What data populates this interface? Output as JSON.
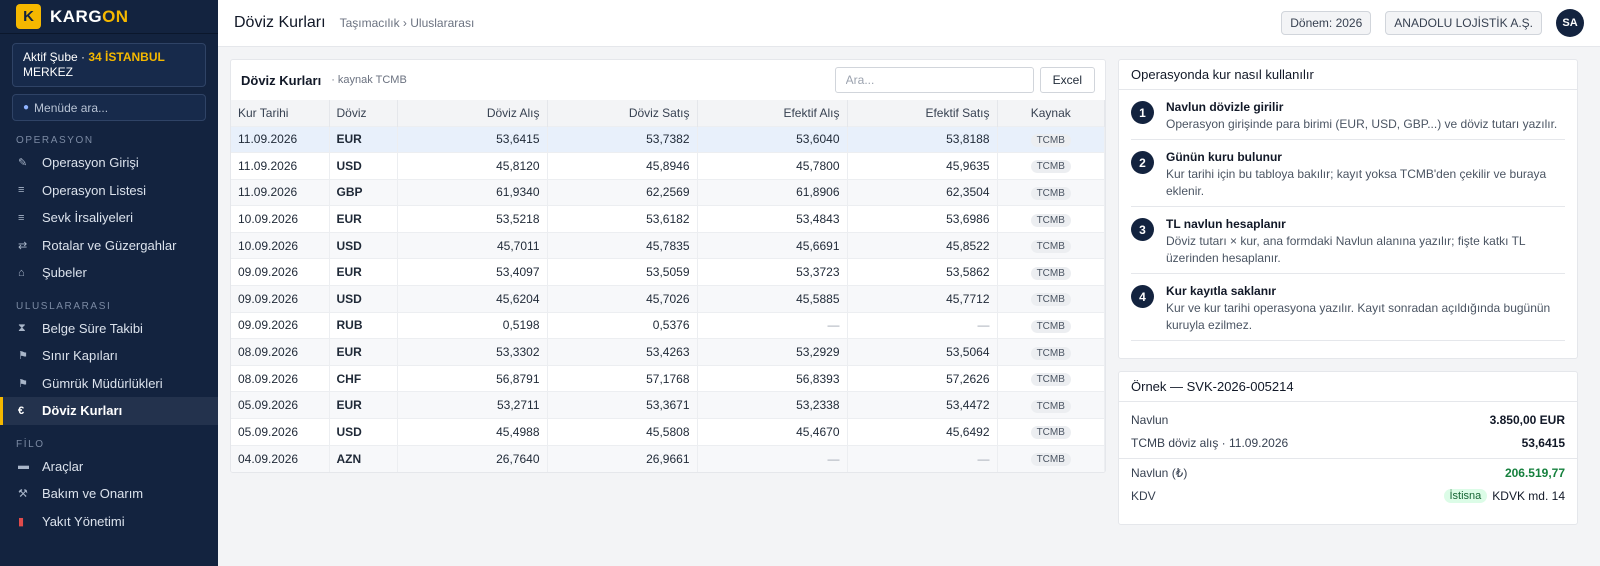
{
  "brand": {
    "logo_letter": "K",
    "name_a": "KARG",
    "name_b": "ON"
  },
  "branch": {
    "label": "Aktif Şube · ",
    "value": "34 İSTANBUL",
    "suffix": "MERKEZ"
  },
  "menu_search": {
    "placeholder": "Menüde ara..."
  },
  "sidebar": {
    "sections": [
      {
        "title": "OPERASYON",
        "items": [
          {
            "label": "Operasyon Girişi",
            "icon": "pencil-icon"
          },
          {
            "label": "Operasyon Listesi",
            "icon": "list-icon"
          },
          {
            "label": "Sevk İrsaliyeleri",
            "icon": "list-icon"
          },
          {
            "label": "Rotalar ve Güzergahlar",
            "icon": "swap-icon"
          },
          {
            "label": "Şubeler",
            "icon": "home-icon"
          }
        ]
      },
      {
        "title": "ULUSLARARASI",
        "items": [
          {
            "label": "Belge Süre Takibi",
            "icon": "hourglass-icon"
          },
          {
            "label": "Sınır Kapıları",
            "icon": "flag-icon"
          },
          {
            "label": "Gümrük Müdürlükleri",
            "icon": "flag-icon"
          },
          {
            "label": "Döviz Kurları",
            "icon": "euro-icon",
            "active": true
          }
        ]
      },
      {
        "title": "FİLO",
        "items": [
          {
            "label": "Araçlar",
            "icon": "truck-icon"
          },
          {
            "label": "Bakım ve Onarım",
            "icon": "wrench-icon"
          },
          {
            "label": "Yakıt Yönetimi",
            "icon": "fuel-icon"
          }
        ]
      }
    ]
  },
  "topbar": {
    "title": "Döviz Kurları",
    "breadcrumb": "Taşımacılık › Uluslararası",
    "period": "Dönem: 2026",
    "company": "ANADOLU LOJİSTİK A.Ş.",
    "avatar": "SA"
  },
  "rates": {
    "title": "Döviz Kurları",
    "subtitle": "· kaynak TCMB",
    "search_placeholder": "Ara...",
    "excel_label": "Excel",
    "columns": [
      "Kur Tarihi",
      "Döviz",
      "Döviz Alış",
      "Döviz Satış",
      "Efektif Alış",
      "Efektif Satış",
      "Kaynak"
    ],
    "rows": [
      [
        "11.09.2026",
        "EUR",
        "53,6415",
        "53,7382",
        "53,6040",
        "53,8188",
        "TCMB"
      ],
      [
        "11.09.2026",
        "USD",
        "45,8120",
        "45,8946",
        "45,7800",
        "45,9635",
        "TCMB"
      ],
      [
        "11.09.2026",
        "GBP",
        "61,9340",
        "62,2569",
        "61,8906",
        "62,3504",
        "TCMB"
      ],
      [
        "10.09.2026",
        "EUR",
        "53,5218",
        "53,6182",
        "53,4843",
        "53,6986",
        "TCMB"
      ],
      [
        "10.09.2026",
        "USD",
        "45,7011",
        "45,7835",
        "45,6691",
        "45,8522",
        "TCMB"
      ],
      [
        "09.09.2026",
        "EUR",
        "53,4097",
        "53,5059",
        "53,3723",
        "53,5862",
        "TCMB"
      ],
      [
        "09.09.2026",
        "USD",
        "45,6204",
        "45,7026",
        "45,5885",
        "45,7712",
        "TCMB"
      ],
      [
        "09.09.2026",
        "RUB",
        "0,5198",
        "0,5376",
        "—",
        "—",
        "TCMB"
      ],
      [
        "08.09.2026",
        "EUR",
        "53,3302",
        "53,4263",
        "53,2929",
        "53,5064",
        "TCMB"
      ],
      [
        "08.09.2026",
        "CHF",
        "56,8791",
        "57,1768",
        "56,8393",
        "57,2626",
        "TCMB"
      ],
      [
        "05.09.2026",
        "EUR",
        "53,2711",
        "53,3671",
        "53,2338",
        "53,4472",
        "TCMB"
      ],
      [
        "05.09.2026",
        "USD",
        "45,4988",
        "45,5808",
        "45,4670",
        "45,6492",
        "TCMB"
      ],
      [
        "04.09.2026",
        "AZN",
        "26,7640",
        "26,9661",
        "—",
        "—",
        "TCMB"
      ]
    ]
  },
  "howto": {
    "title": "Operasyonda kur nasıl kullanılır",
    "steps": [
      {
        "num": "1",
        "title": "Navlun dövizle girilir",
        "desc": "Operasyon girişinde para birimi (EUR, USD, GBP...) ve döviz tutarı yazılır."
      },
      {
        "num": "2",
        "title": "Günün kuru bulunur",
        "desc": "Kur tarihi için bu tabloya bakılır; kayıt yoksa TCMB'den çekilir ve buraya eklenir."
      },
      {
        "num": "3",
        "title": "TL navlun hesaplanır",
        "desc": "Döviz tutarı × kur, ana formdaki Navlun alanına yazılır; fişte katkı TL üzerinden hesaplanır."
      },
      {
        "num": "4",
        "title": "Kur kayıtla saklanır",
        "desc": "Kur ve kur tarihi operasyona yazılır. Kayıt sonradan açıldığında bugünün kuruyla ezilmez."
      }
    ]
  },
  "example": {
    "title": "Örnek — SVK-2026-005214",
    "rows": [
      {
        "label": "Navlun",
        "value": "3.850,00 EUR"
      },
      {
        "label": "TCMB döviz alış · 11.09.2026",
        "value": "53,6415"
      },
      {
        "label": "Navlun (₺)",
        "value": "206.519,77"
      },
      {
        "label": "KDV",
        "badge": "İstisna",
        "value": "KDVK md. 14"
      }
    ]
  }
}
